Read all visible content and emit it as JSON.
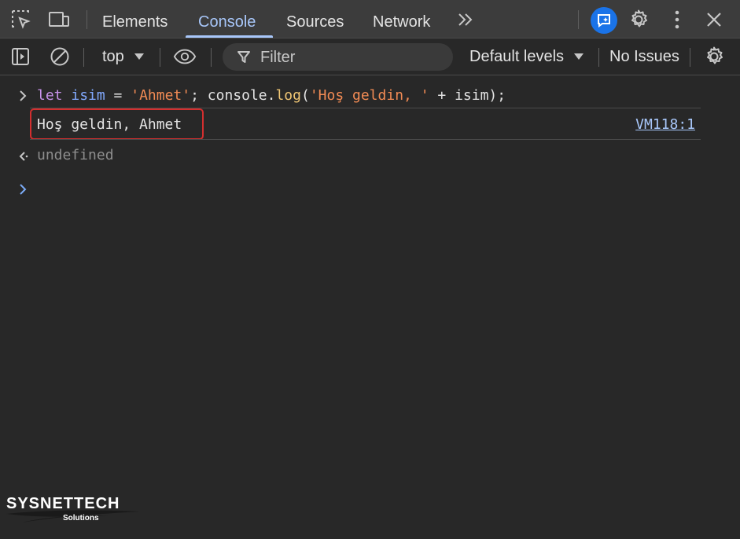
{
  "tabs": {
    "elements": "Elements",
    "console": "Console",
    "sources": "Sources",
    "network": "Network"
  },
  "toolbar": {
    "context": "top",
    "filter_placeholder": "Filter",
    "levels": "Default levels",
    "issues": "No Issues"
  },
  "console": {
    "input": {
      "kw": "let",
      "var1": "isim",
      "eq": " = ",
      "str1": "'Ahmet'",
      "mid": "; console.",
      "fn": "log",
      "open": "(",
      "str2": "'Hoş geldin, '",
      "plus": " + ",
      "var2": "isim",
      "close": ");"
    },
    "output": "Hoş geldin, Ahmet",
    "source_link": "VM118:1",
    "result": "undefined"
  },
  "watermark": {
    "title": "SYSNETTECH",
    "subtitle": "Solutions"
  },
  "colors": {
    "accent": "#a8c7fa",
    "highlight_border": "#d32f2f",
    "ai_button": "#1a73e8"
  }
}
